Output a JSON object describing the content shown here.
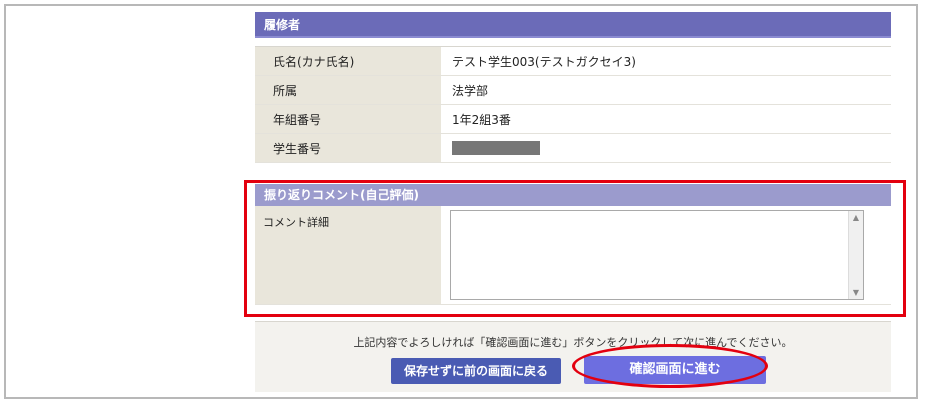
{
  "student_section": {
    "title": "履修者",
    "rows": [
      {
        "label": "氏名(カナ氏名)",
        "value": "テスト学生003(テストガクセイ3)"
      },
      {
        "label": "所属",
        "value": "法学部"
      },
      {
        "label": "年組番号",
        "value": "1年2組3番"
      },
      {
        "label": "学生番号",
        "value": ""
      }
    ]
  },
  "reflection_section": {
    "title": "振り返りコメント(自己評価)",
    "comment_label": "コメント詳細",
    "comment_value": ""
  },
  "footer": {
    "note": "上記内容でよろしければ「確認画面に進む」ボタンをクリックして次に進んでください。",
    "back_button": "保存せずに前の画面に戻る",
    "next_button": "確認画面に進む"
  },
  "colors": {
    "header_bg": "#6b6bb8",
    "subheader_bg": "#9b9bcd",
    "highlight": "#e3000f",
    "next_button": "#6d6ee0",
    "back_button": "#4a5bb3"
  }
}
